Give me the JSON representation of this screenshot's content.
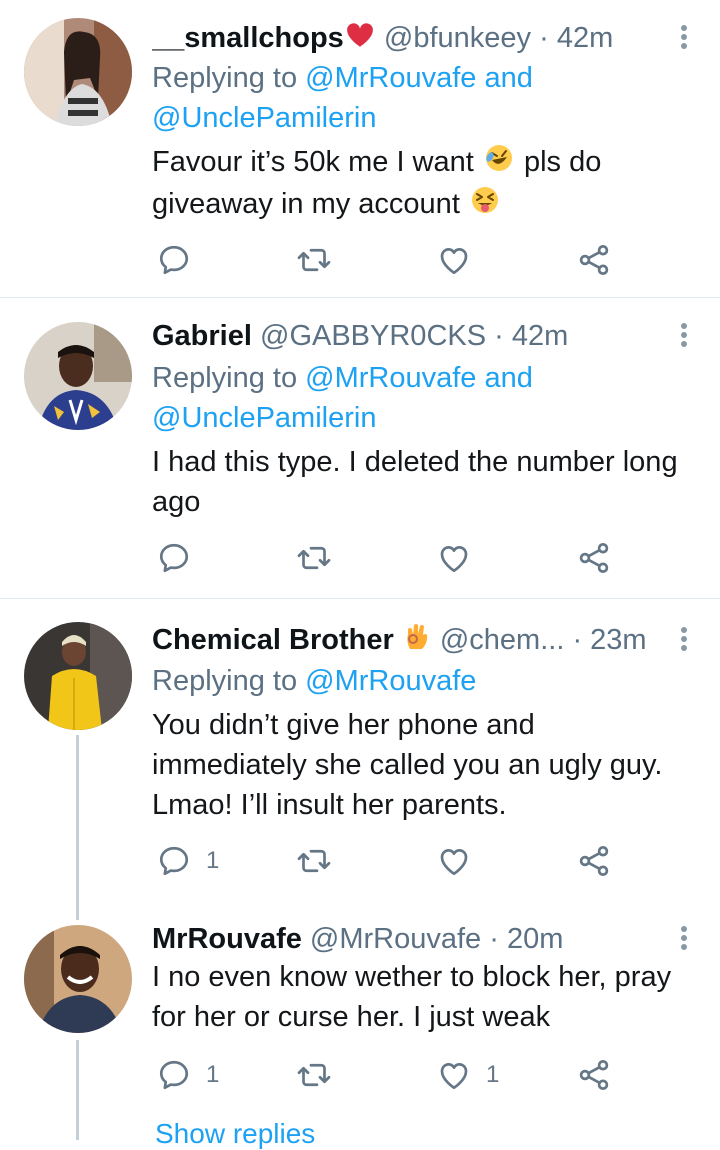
{
  "tweets": [
    {
      "name": "__smallchops",
      "name_emoji": "red-heart",
      "handle": "@bfunkeey",
      "sep": " · ",
      "time": "42m",
      "replying_prefix": "Replying to ",
      "replying_to": "@MrRouvafe and",
      "replying_to_2": "@UnclePamilerin",
      "text_1": "Favour it’s 50k me I want",
      "text_1b": "pls do",
      "text_2": "giveaway in my account",
      "emoji_a": "rolling-on-floor-laughing",
      "emoji_b": "squinting-face-tongue",
      "reply_count": "",
      "retweet_count": "",
      "like_count": ""
    },
    {
      "name": "Gabriel",
      "handle": "@GABBYR0CKS",
      "sep": " · ",
      "time": "42m",
      "replying_prefix": "Replying to ",
      "replying_to": "@MrRouvafe and",
      "replying_to_2": "@UnclePamilerin",
      "text_1": "I had this type. I deleted the number long",
      "text_2": "ago",
      "reply_count": "",
      "retweet_count": "",
      "like_count": ""
    },
    {
      "name": "Chemical Brother",
      "name_emoji": "ok-hand",
      "handle": "@chem...",
      "sep": " · ",
      "time": "23m",
      "replying_prefix": "Replying to ",
      "replying_to": "@MrRouvafe",
      "text_1": "You didn’t give her phone and",
      "text_2": "immediately she called you an ugly guy.",
      "text_3": "Lmao! I’ll insult her parents.",
      "reply_count": "1",
      "retweet_count": "",
      "like_count": ""
    },
    {
      "name": "MrRouvafe",
      "handle": "@MrRouvafe",
      "sep": " · ",
      "time": "20m",
      "text_1": "I no even know wether to block her, pray",
      "text_2": "for her or curse her. I just weak",
      "reply_count": "1",
      "retweet_count": "",
      "like_count": "1"
    }
  ],
  "show_replies": "Show replies",
  "colors": {
    "link": "#1da1f2",
    "secondary": "#5b7083",
    "icon": "#657786",
    "divider": "#e1e8ed"
  },
  "icons": [
    "reply-icon",
    "retweet-icon",
    "like-icon",
    "share-icon",
    "more-icon"
  ]
}
